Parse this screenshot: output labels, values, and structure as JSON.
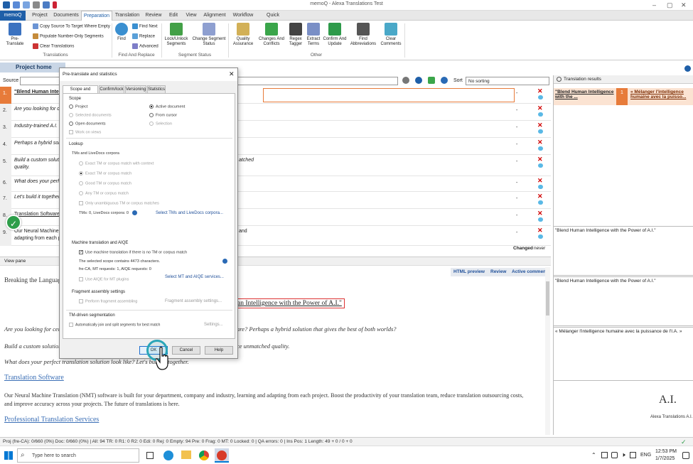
{
  "app": {
    "title": "memoQ - Alexa Translations Test"
  },
  "menu": {
    "tabs": [
      "memoQ",
      "Project",
      "Documents",
      "Preparation",
      "Translation",
      "Review",
      "Edit",
      "View",
      "Alignment",
      "Workflow",
      "Quick Access"
    ]
  },
  "ribbon": {
    "pretranslate": "Pre-Translate",
    "copy_source": "Copy Source To Target Where Empty",
    "populate_numbers": "Populate Number-Only Segments",
    "clear_translations": "Clear Translations",
    "group_translations": "Translations",
    "find": "Find",
    "find_next": "Find Next",
    "replace": "Replace",
    "advanced": "Advanced",
    "group_find": "Find And Replace",
    "lock_unlock": "Lock/Unlock Segments",
    "change_status": "Change Segment Status",
    "group_segment": "Segment Status",
    "quality": "Quality Assurance",
    "changes": "Changes And Conflicts",
    "regex": "Regex Tagger",
    "extract": "Extract Terms",
    "confirm": "Confirm And Update",
    "find_abbr": "Find Abbreviations",
    "clear_comments": "Clear Comments",
    "group_other": "Other"
  },
  "editor": {
    "project_home": "Project home",
    "source_label": "Source",
    "sort_label": "Sort",
    "sort_value": "No sorting",
    "segments": [
      {
        "num": "1.",
        "src": "\"Blend Human Intel",
        "status": "-"
      },
      {
        "num": "2.",
        "src": "Are you looking for ce",
        "status": "-"
      },
      {
        "num": "3.",
        "src": "Industry-trained A.I. t",
        "status": "-"
      },
      {
        "num": "4.",
        "src": "Perhaps a hybrid solu",
        "status": "-"
      },
      {
        "num": "5.",
        "src": "Build a custom solutio",
        "src2": "quality.",
        "right": "atched",
        "status": "-"
      },
      {
        "num": "6.",
        "src": "What does your perfe",
        "status": "-"
      },
      {
        "num": "7.",
        "src": "Let's build it together",
        "status": "-"
      },
      {
        "num": "8.",
        "src": "Translation Software",
        "status": "-"
      },
      {
        "num": "9.",
        "src": "Our Neural Machine T",
        "src2": "adapting from each pr",
        "right": "and",
        "status": "-"
      }
    ],
    "changed_label": "Changed",
    "changed_value": "never"
  },
  "viewpane": {
    "title": "View pane",
    "tabs": [
      "HTML preview",
      "Review",
      "Active comments"
    ],
    "heading": "Breaking the Language",
    "highlight": "an Intelligence with the Power of A.I.\"",
    "p1": "Are you looking for cert",
    "p1b": "are? Perhaps a hybrid solution that gives the best of both worlds?",
    "p2": "Build a custom solution",
    "p2b": "ce unmatched quality.",
    "p3": "What does your perfect translation solution look like? Let's build it together.",
    "link1": "Translation Software",
    "p4": "Our Neural Machine Translation (NMT) software is built for your department, company and industry, learning and adapting from each project. Boost the productivity of your translation team, reduce translation outsourcing costs,",
    "p4b": "and improve accuracy across your projects. The future of translations is here.",
    "link2": "Professional Translation Services"
  },
  "results": {
    "title": "Translation results",
    "hit_src": "\"Blend Human Intelligence with the ...",
    "hit_num": "1",
    "hit_tgt": "« Mélanger l'intelligence humaine avec la puisso...",
    "box1": "\"Blend Human Intelligence with the Power of A.I.\"",
    "box2": "\"Blend Human Intelligence with the Power of A.I.\"",
    "box3": "« Mélanger l'intelligence humaine avec la puissance de l'I.A. »",
    "logo": "A.I.",
    "brand": "Alexa Translations A.I."
  },
  "dialog": {
    "title": "Pre-translate and statistics",
    "tabs": [
      "Scope and lookup",
      "Confirm/lock",
      "Versioning",
      "Statistics"
    ],
    "scope_title": "Scope",
    "scope": {
      "project": "Project",
      "active_doc": "Active document",
      "selected_docs": "Selected documents",
      "from_cursor": "From cursor",
      "open_docs": "Open documents",
      "selection": "Selection",
      "work_on_views": "Work on views"
    },
    "lookup_title": "Lookup",
    "tm_title": "TMs and LiveDocs corpora",
    "tm_opts": [
      "Exact TM or corpus match with context",
      "Exact TM or corpus match",
      "Good TM or corpus match",
      "Any TM or corpus match",
      "Only unambiguous TM or corpus matches"
    ],
    "tms_count": "TMs: 0, LiveDocs corpora: 0",
    "tms_link": "Select TMs and LiveDocs corpora...",
    "mt_title": "Machine translation and AIQE",
    "mt_use": "Use machine translation if there is no TM or corpus match",
    "mt_chars": "The selected scope contains 4473 characters.",
    "mt_requests": "fre-CA, MT requests: 1, AIQE requests: 0",
    "aiqe": "Use AIQE for MT plugins",
    "mt_link": "Select MT and AIQE services...",
    "frag_title": "Fragment assembly settings",
    "frag_opt": "Perform fragment assembling",
    "frag_link": "Fragment assembly settings...",
    "tmseg_title": "TM-driven segmentation",
    "tmseg_opt": "Automatically join and split segments for best match",
    "tmseg_link": "Settings...",
    "ok": "OK",
    "cancel": "Cancel",
    "help": "Help"
  },
  "status": {
    "text": "Proj (fre-CA): 0/660 (0%)  Doc: 0/660 (0%)  |  All: 94   TR: 0   R1: 0   R2: 0   Edi: 0   Rej: 0   Empty: 94   Pre: 0   Frag: 0   MT: 0   Locked: 0  |  QA errors: 0  |  Ins  Pos: 1  Length: 49 + 0 / 0 + 0"
  },
  "taskbar": {
    "search": "Type here to search",
    "lang": "ENG",
    "time": "12:53 PM",
    "date": "1/7/2025"
  }
}
